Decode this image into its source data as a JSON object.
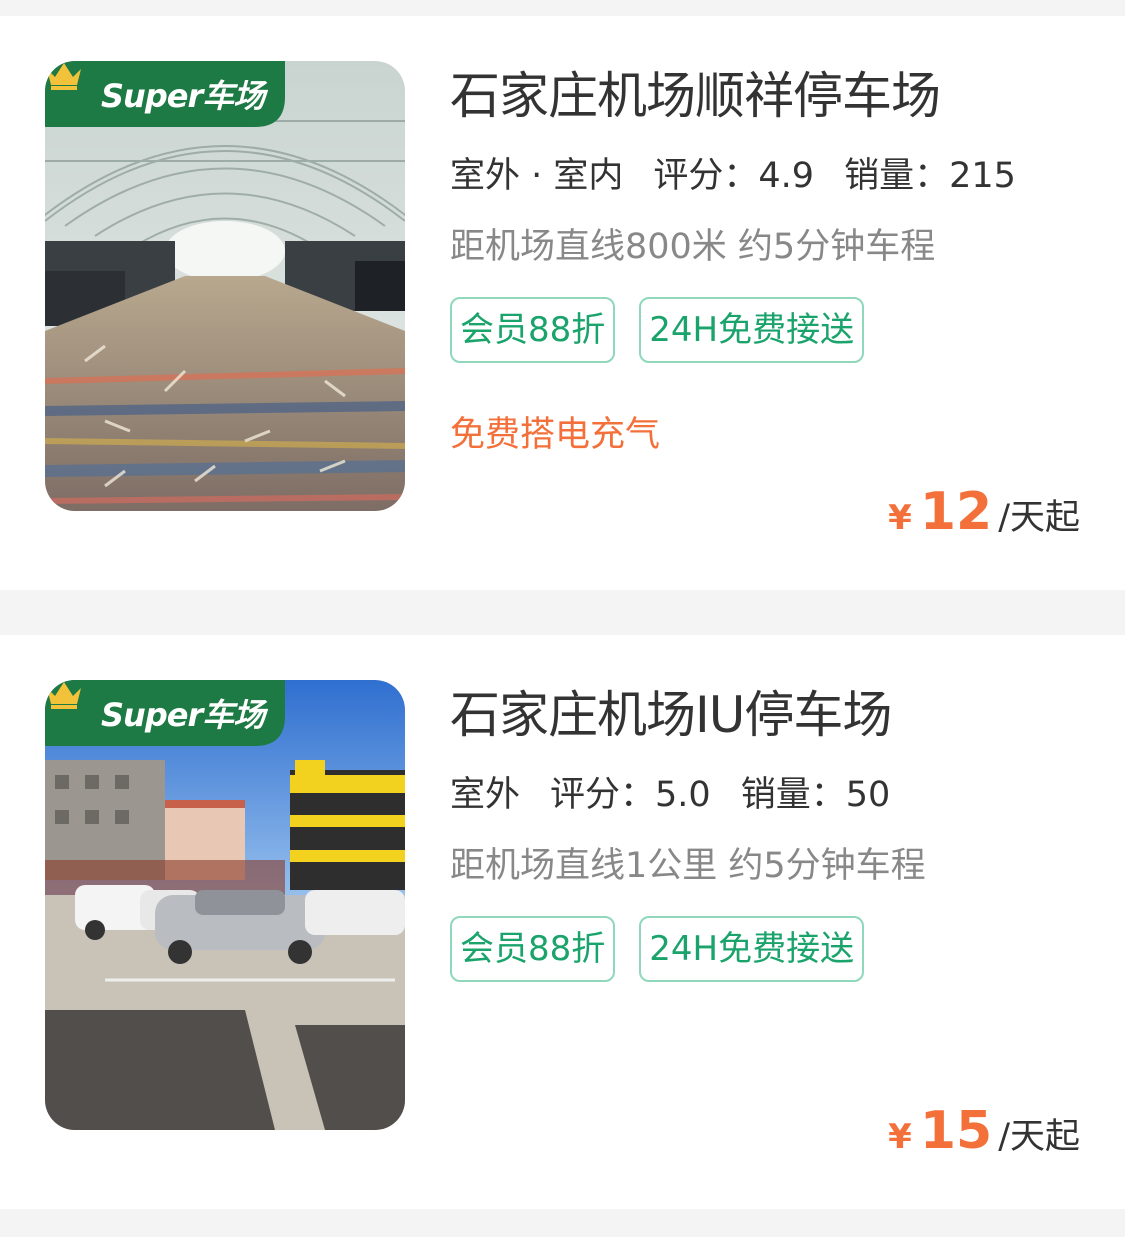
{
  "badge": {
    "label": "Super车场"
  },
  "lots": [
    {
      "title": "石家庄机场顺祥停车场",
      "kind": "室外 · 室内",
      "score_label": "评分：",
      "score": "4.9",
      "sales_label": "销量：",
      "sales": "215",
      "distance": "距机场直线800米 约5分钟车程",
      "tags": [
        "会员88折",
        "24H免费接送"
      ],
      "extra": "免费搭电充气",
      "currency": "¥",
      "price": "12",
      "unit": "/天起",
      "photo_icon": "parking-shed-photo"
    },
    {
      "title": "石家庄机场IU停车场",
      "kind": "室外",
      "score_label": "评分：",
      "score": "5.0",
      "sales_label": "销量：",
      "sales": "50",
      "distance": "距机场直线1公里 约5分钟车程",
      "tags": [
        "会员88折",
        "24H免费接送"
      ],
      "extra": "",
      "currency": "¥",
      "price": "15",
      "unit": "/天起",
      "photo_icon": "outdoor-lot-photo"
    }
  ],
  "colors": {
    "accent_green": "#1ba36c",
    "price_orange": "#f4703a",
    "badge_green": "#1e7a45"
  }
}
